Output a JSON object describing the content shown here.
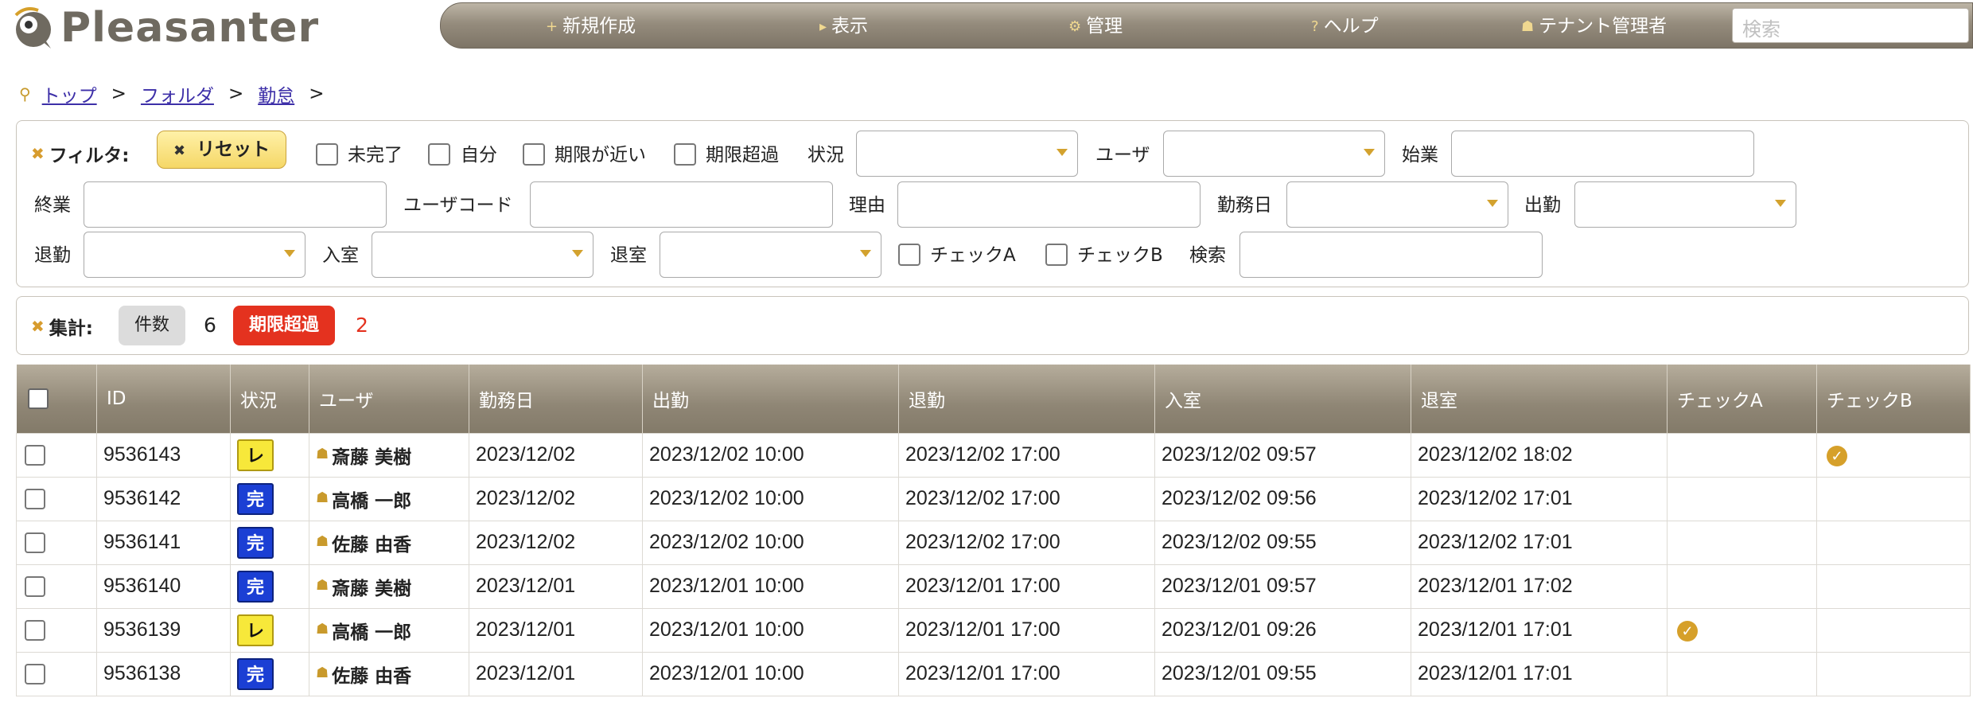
{
  "app": {
    "name": "Pleasanter"
  },
  "nav": {
    "items": [
      {
        "label": "新規作成",
        "icon": "plus-icon",
        "glyph": "+"
      },
      {
        "label": "表示",
        "icon": "triangle-right-icon",
        "glyph": "▸"
      },
      {
        "label": "管理",
        "icon": "gear-icon",
        "glyph": "⚙"
      },
      {
        "label": "ヘルプ",
        "icon": "question-icon",
        "glyph": "?"
      },
      {
        "label": "テナント管理者",
        "icon": "user-icon",
        "glyph": "☗"
      }
    ],
    "search_placeholder": "検索"
  },
  "breadcrumb": {
    "items": [
      "トップ",
      "フォルダ",
      "勤怠"
    ],
    "separator": ">"
  },
  "filter": {
    "title": "フィルタ:",
    "reset_label": "リセット",
    "checks": {
      "incomplete": "未完了",
      "mine": "自分",
      "near_due": "期限が近い",
      "overdue": "期限超過",
      "check_a": "チェックA",
      "check_b": "チェックB"
    },
    "labels": {
      "status": "状況",
      "user": "ユーザ",
      "start": "始業",
      "end": "終業",
      "user_code": "ユーザコード",
      "reason": "理由",
      "work_date": "勤務日",
      "clock_in": "出勤",
      "clock_out": "退勤",
      "room_in": "入室",
      "room_out": "退室",
      "search": "検索"
    }
  },
  "aggregation": {
    "title": "集計:",
    "count_label": "件数",
    "count_value": "6",
    "overdue_label": "期限超過",
    "overdue_value": "2"
  },
  "table": {
    "columns": [
      "ID",
      "状況",
      "ユーザ",
      "勤務日",
      "出勤",
      "退勤",
      "入室",
      "退室",
      "チェックA",
      "チェックB"
    ],
    "rows": [
      {
        "id": "9536143",
        "status": "レ",
        "status_type": "review",
        "user": "斎藤 美樹",
        "date": "2023/12/02",
        "in": "2023/12/02 10:00",
        "out": "2023/12/02 17:00",
        "room_in": "2023/12/02 09:57",
        "room_out": "2023/12/02 18:02",
        "check_a": false,
        "check_b": true
      },
      {
        "id": "9536142",
        "status": "完",
        "status_type": "done",
        "user": "高橋 一郎",
        "date": "2023/12/02",
        "in": "2023/12/02 10:00",
        "out": "2023/12/02 17:00",
        "room_in": "2023/12/02 09:56",
        "room_out": "2023/12/02 17:01",
        "check_a": false,
        "check_b": false
      },
      {
        "id": "9536141",
        "status": "完",
        "status_type": "done",
        "user": "佐藤 由香",
        "date": "2023/12/02",
        "in": "2023/12/02 10:00",
        "out": "2023/12/02 17:00",
        "room_in": "2023/12/02 09:55",
        "room_out": "2023/12/02 17:01",
        "check_a": false,
        "check_b": false
      },
      {
        "id": "9536140",
        "status": "完",
        "status_type": "done",
        "user": "斎藤 美樹",
        "date": "2023/12/01",
        "in": "2023/12/01 10:00",
        "out": "2023/12/01 17:00",
        "room_in": "2023/12/01 09:57",
        "room_out": "2023/12/01 17:02",
        "check_a": false,
        "check_b": false
      },
      {
        "id": "9536139",
        "status": "レ",
        "status_type": "review",
        "user": "高橋 一郎",
        "date": "2023/12/01",
        "in": "2023/12/01 10:00",
        "out": "2023/12/01 17:00",
        "room_in": "2023/12/01 09:26",
        "room_out": "2023/12/01 17:01",
        "check_a": true,
        "check_b": false
      },
      {
        "id": "9536138",
        "status": "完",
        "status_type": "done",
        "user": "佐藤 由香",
        "date": "2023/12/01",
        "in": "2023/12/01 10:00",
        "out": "2023/12/01 17:00",
        "room_in": "2023/12/01 09:55",
        "room_out": "2023/12/01 17:01",
        "check_a": false,
        "check_b": false
      }
    ]
  },
  "colors": {
    "accent": "#d6a02a",
    "header_bar": "#958c7d",
    "status_done": "#1b3fd4",
    "status_review": "#f7e83a",
    "overdue": "#e4321f",
    "link": "#3d2fa8"
  }
}
